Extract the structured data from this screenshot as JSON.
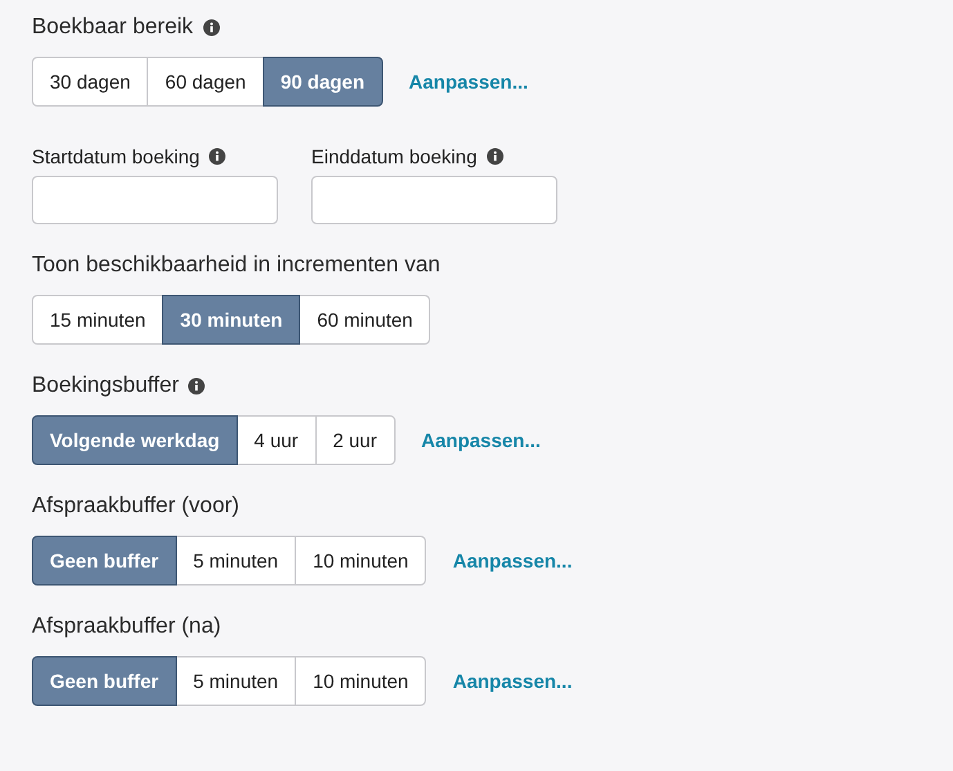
{
  "sections": [
    {
      "kind": "options",
      "title": "Boekbaar bereik",
      "info": true,
      "options": [
        {
          "label": "30 dagen",
          "selected": false
        },
        {
          "label": "60 dagen",
          "selected": false
        },
        {
          "label": "90 dagen",
          "selected": true
        }
      ],
      "link": "Aanpassen..."
    },
    {
      "kind": "dates",
      "fields": [
        {
          "label": "Startdatum boeking",
          "info": true
        },
        {
          "label": "Einddatum boeking",
          "info": true
        }
      ]
    },
    {
      "kind": "options",
      "title": "Toon beschikbaarheid in incrementen van",
      "info": false,
      "options": [
        {
          "label": "15 minuten",
          "selected": false
        },
        {
          "label": "30 minuten",
          "selected": true
        },
        {
          "label": "60 minuten",
          "selected": false
        }
      ]
    },
    {
      "kind": "options",
      "title": "Boekingsbuffer",
      "info": true,
      "options": [
        {
          "label": "Volgende werkdag",
          "selected": true
        },
        {
          "label": "4 uur",
          "selected": false
        },
        {
          "label": "2 uur",
          "selected": false
        }
      ],
      "link": "Aanpassen..."
    },
    {
      "kind": "options",
      "title": "Afspraakbuffer (voor)",
      "info": false,
      "options": [
        {
          "label": "Geen buffer",
          "selected": true
        },
        {
          "label": "5 minuten",
          "selected": false
        },
        {
          "label": "10 minuten",
          "selected": false
        }
      ],
      "link": "Aanpassen..."
    },
    {
      "kind": "options",
      "title": "Afspraakbuffer (na)",
      "info": false,
      "options": [
        {
          "label": "Geen buffer",
          "selected": true
        },
        {
          "label": "5 minuten",
          "selected": false
        },
        {
          "label": "10 minuten",
          "selected": false
        }
      ],
      "link": "Aanpassen..."
    }
  ]
}
